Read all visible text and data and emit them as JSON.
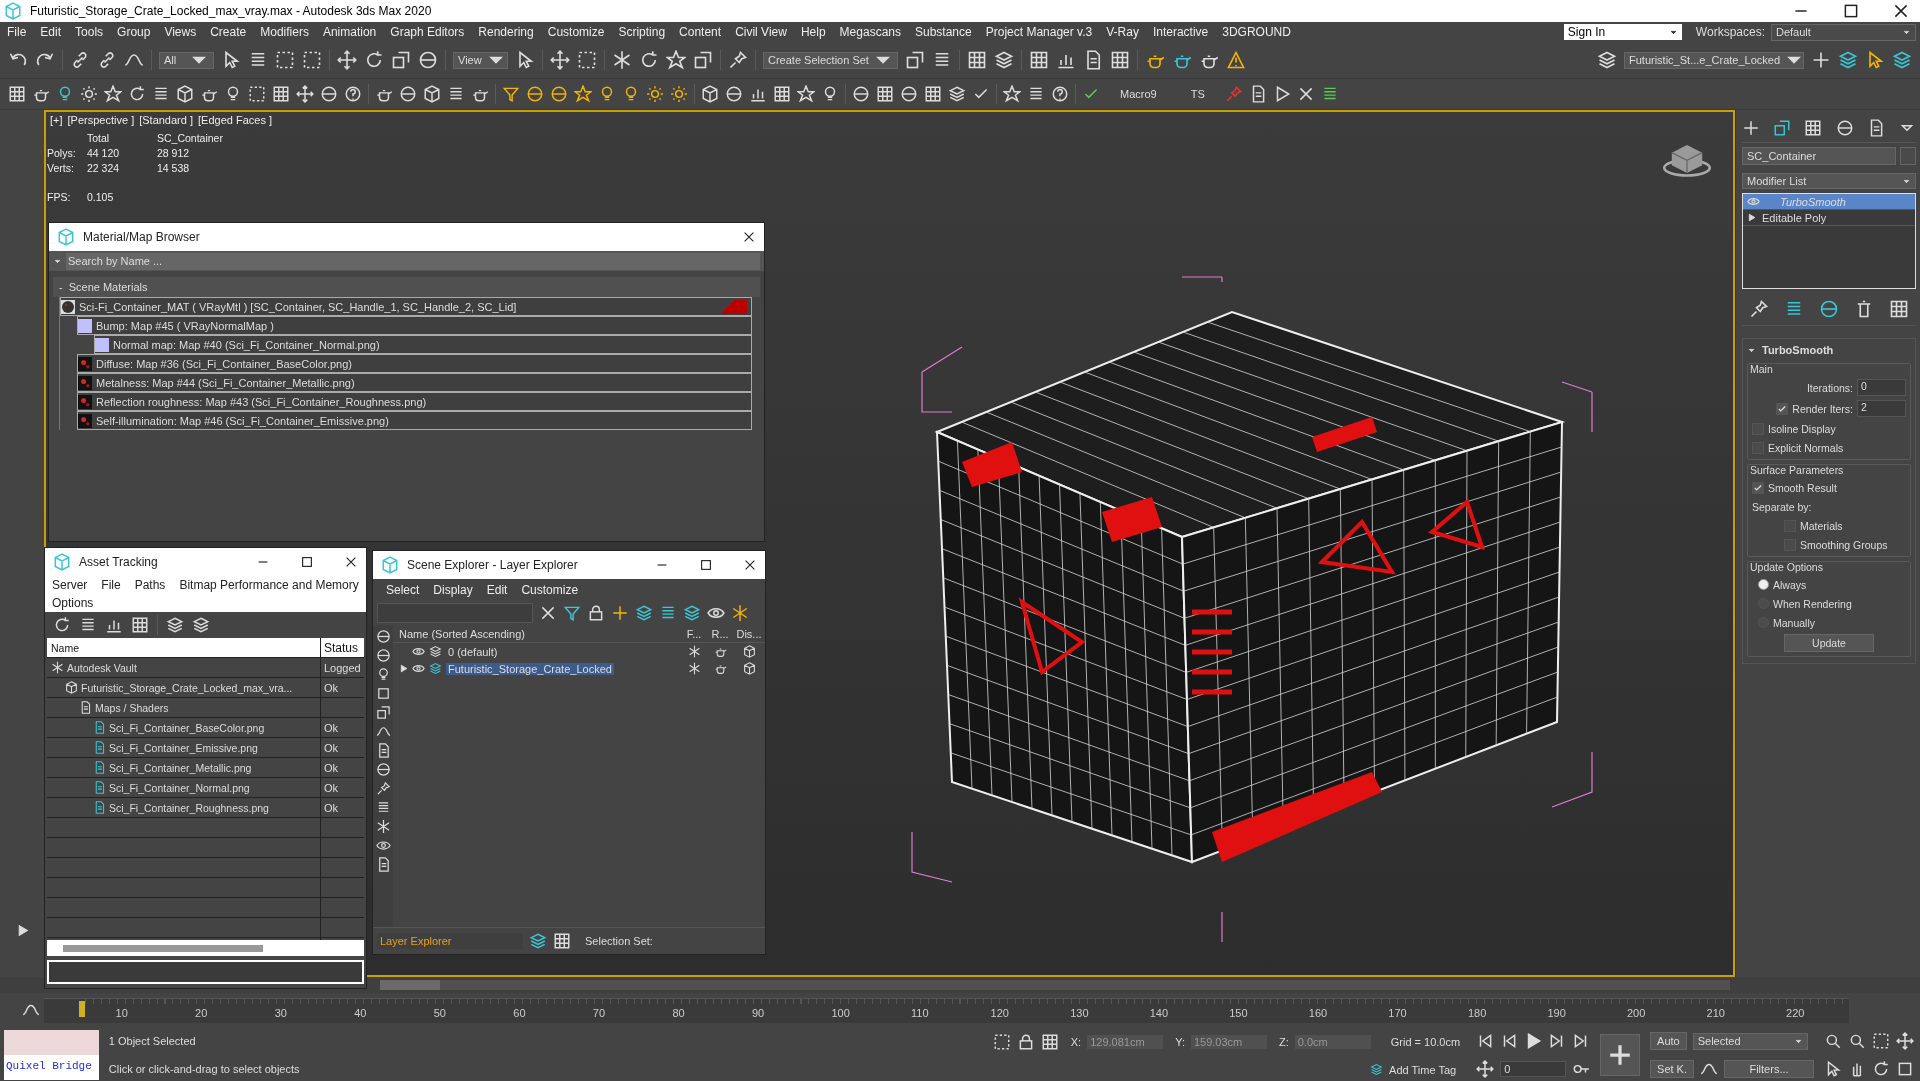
{
  "title_bar": {
    "title": "Futuristic_Storage_Crate_Locked_max_vray.max - Autodesk 3ds Max 2020"
  },
  "menu": [
    "File",
    "Edit",
    "Tools",
    "Group",
    "Views",
    "Create",
    "Modifiers",
    "Animation",
    "Graph Editors",
    "Rendering",
    "Customize",
    "Scripting",
    "Content",
    "Civil View",
    "Help",
    "Megascans",
    "Substance",
    "Project Manager v.3",
    "V-Ray",
    "Interactive",
    "3DGROUND"
  ],
  "account": {
    "sign_in": "Sign In",
    "workspaces_label": "Workspaces:",
    "workspace": "Default"
  },
  "toolbar": {
    "selection_filter": "All",
    "reference_coord": "View",
    "selection_set": "Create Selection Set",
    "layer": "Futuristic_St...e_Crate_Locked",
    "macro": "Macro9",
    "ts": "TS"
  },
  "viewport": {
    "labels": [
      "[+]",
      "[Perspective ]",
      "[Standard ]",
      "[Edged Faces ]"
    ],
    "stats": {
      "columns": [
        "Total",
        "SC_Container"
      ],
      "rows": [
        {
          "label": "Polys:",
          "values": [
            "44 120",
            "28 912"
          ]
        },
        {
          "label": "Verts:",
          "values": [
            "22 324",
            "14 538"
          ]
        }
      ],
      "fps_label": "FPS:",
      "fps": "0.105"
    }
  },
  "material_browser": {
    "title": "Material/Map Browser",
    "search_placeholder": "Search by Name ...",
    "group_toggle": "-",
    "group": "Scene Materials",
    "items": [
      {
        "kind": "material",
        "label": "Sci-Fi_Container_MAT  ( VRayMtl )  [SC_Container, SC_Handle_1, SC_Handle_2, SC_Lid]",
        "children": [
          {
            "kind": "swatch",
            "label": "Bump: Map #45  ( VRayNormalMap )",
            "children": [
              {
                "kind": "swatch",
                "label": "Normal map: Map #40 (Sci_Fi_Container_Normal.png)"
              }
            ]
          },
          {
            "kind": "bitmap",
            "label": "Diffuse: Map #36 (Sci_Fi_Container_BaseColor.png)"
          },
          {
            "kind": "bitmap",
            "label": "Metalness: Map #44 (Sci_Fi_Container_Metallic.png)"
          },
          {
            "kind": "bitmap",
            "label": "Reflection roughness: Map #43 (Sci_Fi_Container_Roughness.png)"
          },
          {
            "kind": "bitmap",
            "label": "Self-illumination: Map #46 (Sci_Fi_Container_Emissive.png)"
          }
        ]
      }
    ]
  },
  "asset_tracking": {
    "title": "Asset Tracking",
    "menu": [
      "Server",
      "File",
      "Paths",
      "Bitmap Performance and Memory",
      "Options"
    ],
    "columns": [
      "Name",
      "Status"
    ],
    "rows": [
      {
        "kind": "vault",
        "name": "Autodesk Vault",
        "status": "Logged",
        "children": [
          {
            "kind": "scene",
            "name": "Futuristic_Storage_Crate_Locked_max_vra...",
            "status": "Ok",
            "children": [
              {
                "kind": "folder",
                "name": "Maps / Shaders",
                "children": [
                  {
                    "kind": "image",
                    "name": "Sci_Fi_Container_BaseColor.png",
                    "status": "Ok"
                  },
                  {
                    "kind": "image",
                    "name": "Sci_Fi_Container_Emissive.png",
                    "status": "Ok"
                  },
                  {
                    "kind": "image",
                    "name": "Sci_Fi_Container_Metallic.png",
                    "status": "Ok"
                  },
                  {
                    "kind": "image",
                    "name": "Sci_Fi_Container_Normal.png",
                    "status": "Ok"
                  },
                  {
                    "kind": "image",
                    "name": "Sci_Fi_Container_Roughness.png",
                    "status": "Ok"
                  }
                ]
              }
            ]
          }
        ]
      }
    ]
  },
  "scene_explorer": {
    "title": "Scene Explorer - Layer Explorer",
    "menu": [
      "Select",
      "Display",
      "Edit",
      "Customize"
    ],
    "columns": [
      "Name (Sorted Ascending)",
      "F...",
      "R...",
      "Dis..."
    ],
    "layers": [
      {
        "name": "0 (default)",
        "selected": false
      },
      {
        "name": "Futuristic_Storage_Crate_Locked",
        "selected": true,
        "expanded": false
      }
    ],
    "explorer_name": "Layer Explorer",
    "selection_set_label": "Selection Set:"
  },
  "command_panel": {
    "object_name": "SC_Container",
    "modifier_list": "Modifier List",
    "stack": [
      {
        "kind": "modifier",
        "name": "TurboSmooth",
        "selected": true
      },
      {
        "kind": "base",
        "name": "Editable Poly",
        "selected": false
      }
    ],
    "rollout": {
      "title": "TurboSmooth",
      "groups": [
        {
          "title": "Main",
          "controls": [
            {
              "kind": "spinner",
              "label": "Iterations:",
              "value": "0"
            },
            {
              "kind": "check_spinner",
              "label": "Render Iters:",
              "checked": true,
              "value": "2"
            },
            {
              "kind": "checkbox",
              "label": "Isoline Display",
              "checked": false
            },
            {
              "kind": "checkbox",
              "label": "Explicit Normals",
              "checked": false
            }
          ]
        },
        {
          "title": "Surface Parameters",
          "controls": [
            {
              "kind": "checkbox",
              "label": "Smooth Result",
              "checked": true
            },
            {
              "kind": "text",
              "label": "Separate by:"
            },
            {
              "kind": "sub_checkbox",
              "label": "Materials",
              "checked": false
            },
            {
              "kind": "sub_checkbox",
              "label": "Smoothing Groups",
              "checked": false
            }
          ]
        },
        {
          "title": "Update Options",
          "controls": [
            {
              "kind": "radio",
              "label": "Always",
              "selected": true
            },
            {
              "kind": "radio",
              "label": "When Rendering",
              "selected": false
            },
            {
              "kind": "radio",
              "label": "Manually",
              "selected": false
            },
            {
              "kind": "button",
              "label": "Update"
            }
          ]
        }
      ]
    }
  },
  "timeline": {
    "level": 0,
    "labels": [
      "10",
      "20",
      "30",
      "40",
      "50",
      "60",
      "70",
      "80",
      "90",
      "100",
      "110",
      "120",
      "130",
      "140",
      "150",
      "160",
      "170",
      "180",
      "190",
      "200",
      "210",
      "220"
    ]
  },
  "status_bar": {
    "listener": "Quixel Bridge",
    "selection": "1 Object Selected",
    "prompt": "Click or click-and-drag to select objects",
    "x_label": "X:",
    "x": "129.081cm",
    "y_label": "Y:",
    "y": "159.03cm",
    "z_label": "Z:",
    "z": "0.0cm",
    "grid": "Grid = 10.0cm",
    "time_tag": "Add Time Tag",
    "frame": "0",
    "auto": "Auto",
    "key_filter": "Selected",
    "set_key": "Set K.",
    "filters": "Filters..."
  }
}
